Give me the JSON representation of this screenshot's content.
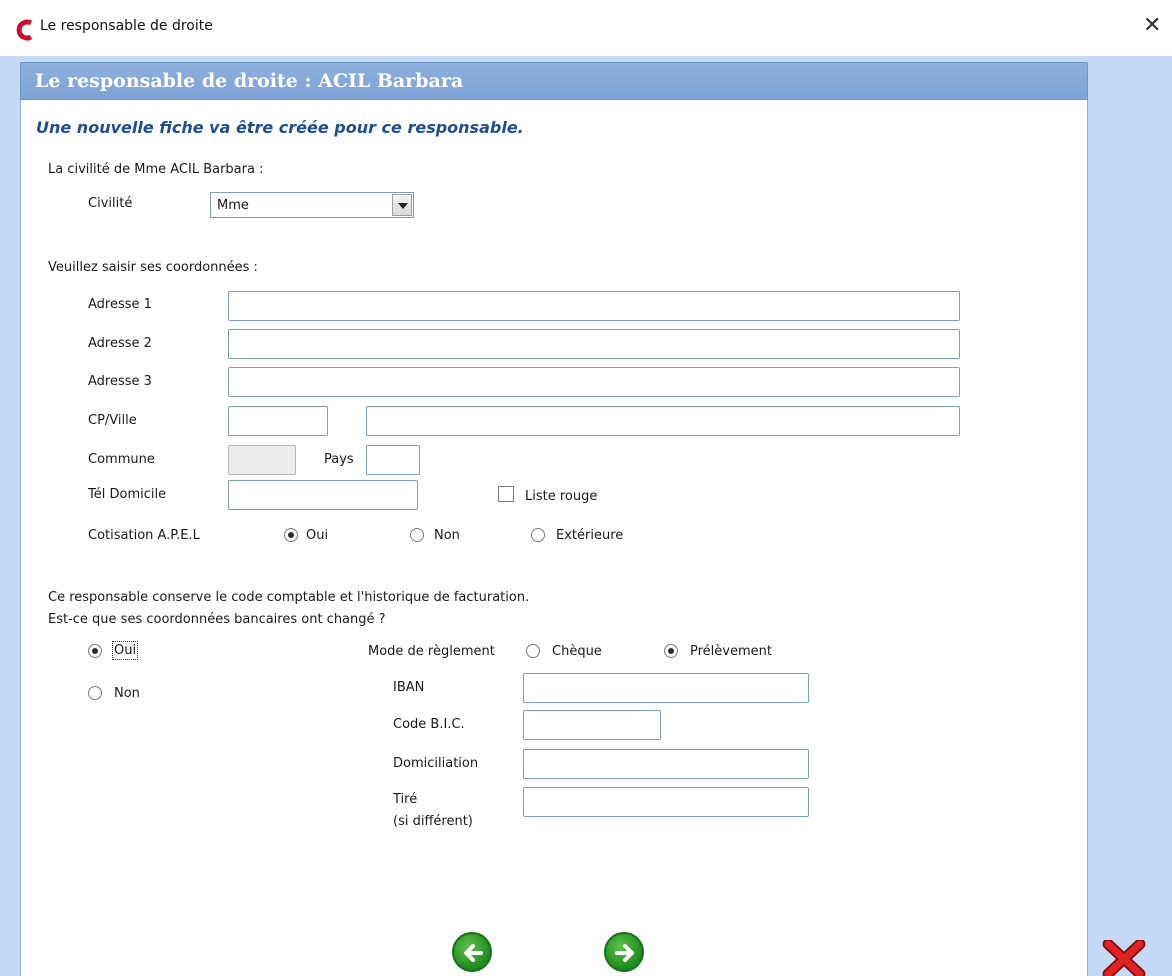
{
  "window": {
    "title": "Le responsable de droite",
    "close_glyph": "✕"
  },
  "panel": {
    "title": "Le responsable de droite : ACIL Barbara",
    "subtitle": "Une nouvelle fiche va être créée pour ce responsable."
  },
  "civilite": {
    "heading": "La civilité de Mme ACIL Barbara :",
    "label": "Civilité",
    "selected": "Mme"
  },
  "coordonnees": {
    "heading": "Veuillez saisir ses coordonnées :",
    "adresse1_label": "Adresse 1",
    "adresse1_value": "",
    "adresse2_label": "Adresse 2",
    "adresse2_value": "",
    "adresse3_label": "Adresse 3",
    "adresse3_value": "",
    "cpville_label": "CP/Ville",
    "cp_value": "",
    "ville_value": "",
    "commune_label": "Commune",
    "commune_value": "",
    "pays_label": "Pays",
    "pays_value": "",
    "tel_label": "Tél Domicile",
    "tel_value": "",
    "liste_rouge_label": "Liste rouge",
    "liste_rouge_checked": false,
    "cotisation_label": "Cotisation A.P.E.L",
    "cotisation_options": [
      "Oui",
      "Non",
      "Extérieure"
    ],
    "cotisation_selected": "Oui"
  },
  "bancaire": {
    "info_line1": "Ce responsable conserve le code comptable et l'historique de facturation.",
    "info_line2": "Est-ce que ses coordonnées bancaires ont changé ?",
    "changed_options": [
      "Oui",
      "Non"
    ],
    "changed_selected": "Oui",
    "mode_label": "Mode de règlement",
    "mode_options": [
      "Chèque",
      "Prélèvement"
    ],
    "mode_selected": "Prélèvement",
    "iban_label": "IBAN",
    "iban_value": "",
    "bic_label": "Code B.I.C.",
    "bic_value": "",
    "domiciliation_label": "Domiciliation",
    "domiciliation_value": "",
    "tire_label_line1": "Tiré",
    "tire_label_line2": "(si différent)",
    "tire_value": ""
  },
  "icons": {
    "app_logo": "app-logo-icon",
    "back": "arrow-left-icon",
    "next": "arrow-right-icon",
    "cancel": "red-cross-icon"
  },
  "colors": {
    "frame_bg": "#c4d9f5",
    "header_bg": "#8fb0de",
    "subtitle": "#1f4f8c",
    "nav_green": "#1e8a1e",
    "cancel_red": "#d42020"
  }
}
